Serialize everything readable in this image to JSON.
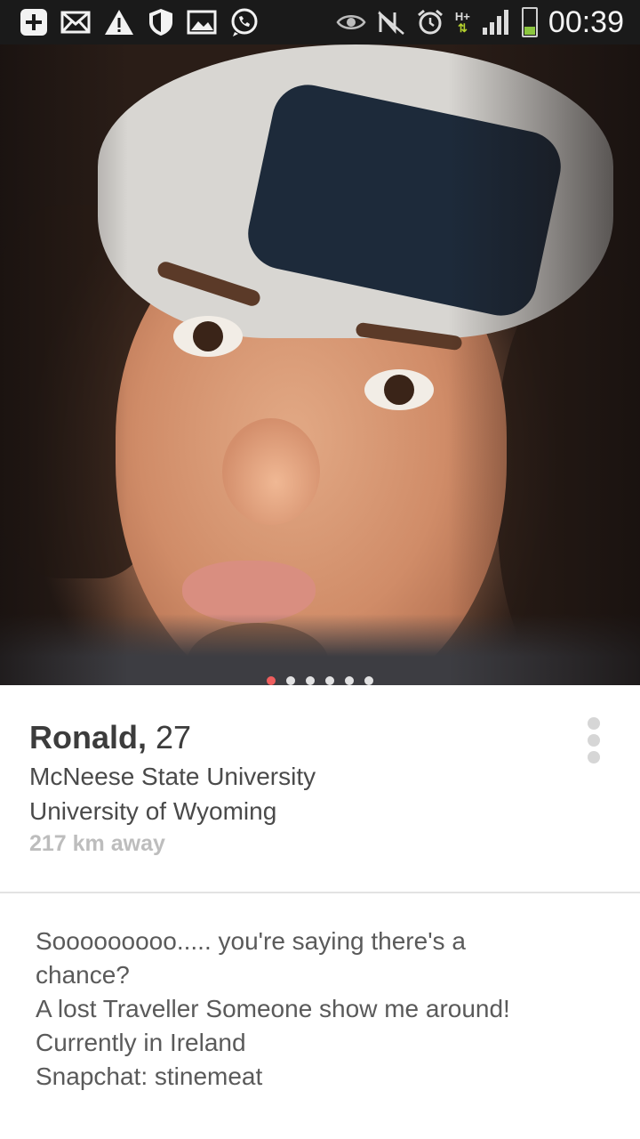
{
  "status_bar": {
    "left_icons": [
      "add-icon",
      "mail-icon",
      "warning-icon",
      "shield-icon",
      "image-icon",
      "whatsapp-icon"
    ],
    "right_icons": [
      "eye-icon",
      "nfc-icon",
      "alarm-icon",
      "network-hplus-icon",
      "signal-icon",
      "battery-icon"
    ],
    "network_label": "H+",
    "time": "00:39",
    "battery_level": 0.3
  },
  "photo": {
    "page_count": 6,
    "active_page": 1
  },
  "profile": {
    "name": "Ronald,",
    "age": "27",
    "schools": [
      "McNeese State University",
      "University of Wyoming"
    ],
    "distance": "217 km away"
  },
  "bio": {
    "lines": [
      "Sooooooooo..... you're saying there's a",
      "chance?",
      "A lost Traveller Someone show me around!",
      "Currently in Ireland",
      "Snapchat: stinemeat"
    ]
  },
  "colors": {
    "active_dot": "#ef5e5e",
    "status_bar_bg": "#1a1a1a",
    "accent_green": "#8cc63f"
  }
}
